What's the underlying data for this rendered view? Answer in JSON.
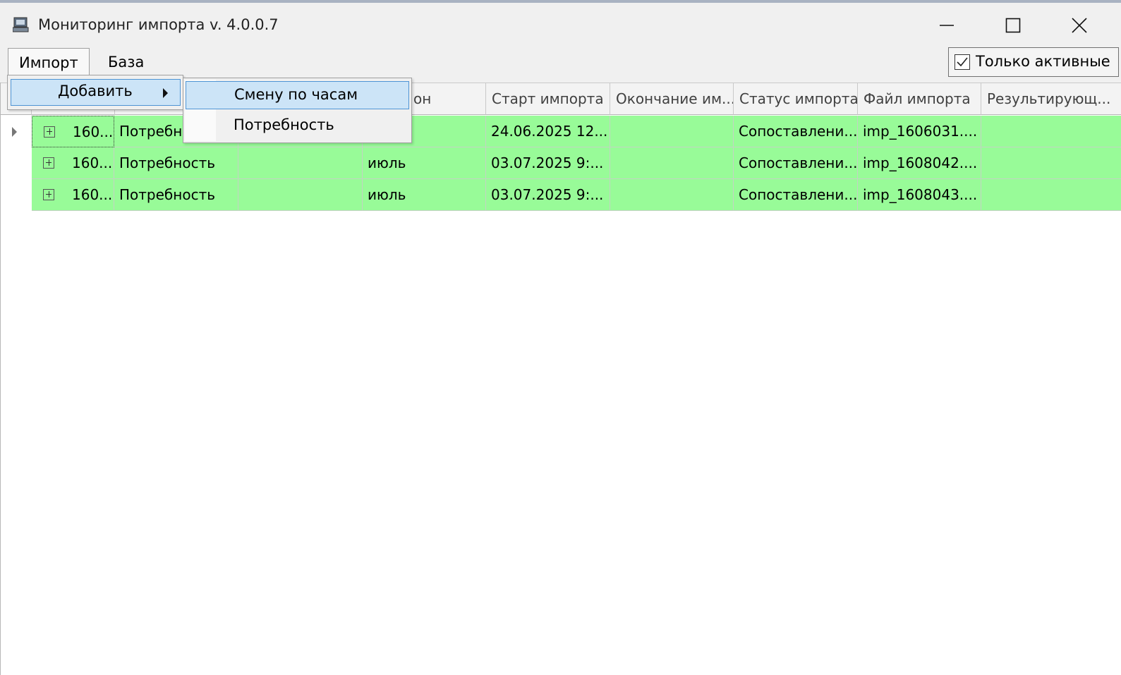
{
  "window": {
    "title": "Мониторинг импорта v. 4.0.0.7"
  },
  "menu": {
    "import": "Импорт",
    "base": "База"
  },
  "only_active": {
    "label": "Только активные",
    "checked": true
  },
  "context_menu": {
    "add": "Добавить",
    "submenu": [
      "Смену по часам",
      "Потребность"
    ]
  },
  "table": {
    "headers": [
      "",
      "",
      "",
      "он",
      "Старт импорта",
      "Окончание им...",
      "Статус импорта",
      "Файл импорта",
      "Результирующ..."
    ],
    "rows": [
      {
        "id": "160...",
        "type": "Потребно",
        "month": "",
        "start": "24.06.2025 12...",
        "end": "",
        "status": "Сопоставлени...",
        "file": "imp_1606031....",
        "result": ""
      },
      {
        "id": "160...",
        "type": "Потребность",
        "month": "июль",
        "start": "03.07.2025 9:...",
        "end": "",
        "status": "Сопоставлени...",
        "file": "imp_1608042....",
        "result": ""
      },
      {
        "id": "160...",
        "type": "Потребность",
        "month": "июль",
        "start": "03.07.2025 9:...",
        "end": "",
        "status": "Сопоставлени...",
        "file": "imp_1608043....",
        "result": ""
      }
    ]
  },
  "colors": {
    "row_bg": "#98fb98",
    "menu_highlight": "#cce4f7",
    "menu_highlight_border": "#4e94d4"
  }
}
